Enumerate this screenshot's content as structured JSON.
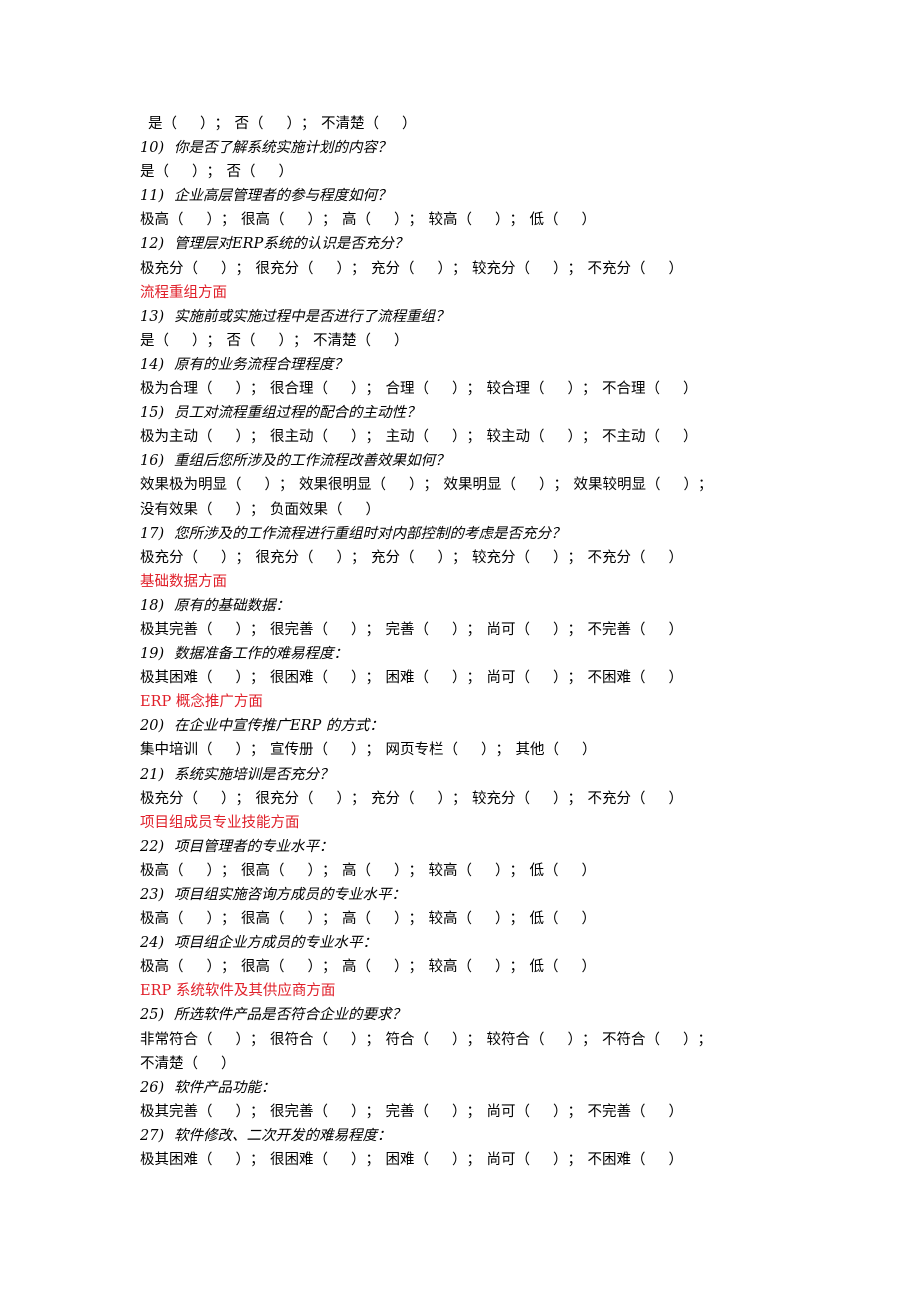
{
  "lines": [
    {
      "type": "options",
      "indent": true,
      "options": [
        "是",
        "否",
        "不清楚"
      ]
    },
    {
      "type": "question",
      "num": "10)",
      "text": "你是否了解系统实施计划的内容？"
    },
    {
      "type": "options",
      "options": [
        "是",
        "否"
      ]
    },
    {
      "type": "question",
      "num": "11)",
      "text": "企业高层管理者的参与程度如何？"
    },
    {
      "type": "options",
      "options": [
        "极高",
        "很高",
        "高",
        "较高",
        "低"
      ]
    },
    {
      "type": "question",
      "num": "12)",
      "text": "管理层对ERP系统的认识是否充分？"
    },
    {
      "type": "options",
      "options": [
        "极充分",
        "很充分",
        "充分",
        "较充分",
        "不充分"
      ]
    },
    {
      "type": "section",
      "text": "流程重组方面"
    },
    {
      "type": "question",
      "num": "13)",
      "text": "实施前或实施过程中是否进行了流程重组？"
    },
    {
      "type": "options",
      "options": [
        "是",
        "否",
        "不清楚"
      ]
    },
    {
      "type": "question",
      "num": "14)",
      "text": "原有的业务流程合理程度？"
    },
    {
      "type": "options",
      "options": [
        "极为合理",
        "很合理",
        "合理",
        "较合理",
        "不合理"
      ]
    },
    {
      "type": "question",
      "num": "15)",
      "text": "员工对流程重组过程的配合的主动性？"
    },
    {
      "type": "options",
      "options": [
        "极为主动",
        "很主动",
        "主动",
        "较主动",
        "不主动"
      ]
    },
    {
      "type": "question",
      "num": "16)",
      "text": "重组后您所涉及的工作流程改善效果如何？"
    },
    {
      "type": "options",
      "trailing_sep": true,
      "options": [
        "效果极为明显",
        "效果很明显",
        "效果明显",
        "效果较明显"
      ]
    },
    {
      "type": "options",
      "options": [
        "没有效果",
        "负面效果"
      ]
    },
    {
      "type": "question",
      "num": "17)",
      "text": "您所涉及的工作流程进行重组时对内部控制的考虑是否充分？"
    },
    {
      "type": "options",
      "options": [
        "极充分",
        "很充分",
        "充分",
        "较充分",
        "不充分"
      ]
    },
    {
      "type": "section",
      "text": "基础数据方面"
    },
    {
      "type": "question",
      "num": "18)",
      "text": "原有的基础数据："
    },
    {
      "type": "options",
      "options": [
        "极其完善",
        "很完善",
        "完善",
        "尚可",
        "不完善"
      ]
    },
    {
      "type": "question",
      "num": "19)",
      "text": "数据准备工作的难易程度："
    },
    {
      "type": "options",
      "options": [
        "极其困难",
        "很困难",
        "困难",
        "尚可",
        "不困难"
      ]
    },
    {
      "type": "section",
      "text": "ERP 概念推广方面"
    },
    {
      "type": "question",
      "num": "20)",
      "text": "在企业中宣传推广ERP 的方式："
    },
    {
      "type": "options",
      "options": [
        "集中培训",
        "宣传册",
        "网页专栏",
        "其他"
      ]
    },
    {
      "type": "question",
      "num": "21)",
      "text": "系统实施培训是否充分？"
    },
    {
      "type": "options",
      "options": [
        "极充分",
        "很充分",
        "充分",
        "较充分",
        "不充分"
      ]
    },
    {
      "type": "section",
      "text": "项目组成员专业技能方面"
    },
    {
      "type": "question",
      "num": "22)",
      "text": "项目管理者的专业水平："
    },
    {
      "type": "options",
      "options": [
        "极高",
        "很高",
        "高",
        "较高",
        "低"
      ]
    },
    {
      "type": "question",
      "num": "23)",
      "text": "项目组实施咨询方成员的专业水平："
    },
    {
      "type": "options",
      "options": [
        "极高",
        "很高",
        "高",
        "较高",
        "低"
      ]
    },
    {
      "type": "question",
      "num": "24)",
      "text": "项目组企业方成员的专业水平："
    },
    {
      "type": "options",
      "options": [
        "极高",
        "很高",
        "高",
        "较高",
        "低"
      ]
    },
    {
      "type": "section",
      "text": "ERP 系统软件及其供应商方面"
    },
    {
      "type": "question",
      "num": "25)",
      "text": "所选软件产品是否符合企业的要求？"
    },
    {
      "type": "options",
      "trailing_sep": true,
      "options": [
        "非常符合",
        "很符合",
        "符合",
        "较符合",
        "不符合"
      ]
    },
    {
      "type": "options",
      "options": [
        "不清楚"
      ]
    },
    {
      "type": "question",
      "num": "26)",
      "text": "软件产品功能："
    },
    {
      "type": "options",
      "options": [
        "极其完善",
        "很完善",
        "完善",
        "尚可",
        "不完善"
      ]
    },
    {
      "type": "question",
      "num": "27)",
      "text": "软件修改、二次开发的难易程度："
    },
    {
      "type": "options",
      "options": [
        "极其困难",
        "很困难",
        "困难",
        "尚可",
        "不困难"
      ]
    }
  ],
  "symbols": {
    "open": "（",
    "close": "）",
    "sep": "；"
  },
  "colors": {
    "section_heading": "#e0202a",
    "text": "#000000"
  }
}
